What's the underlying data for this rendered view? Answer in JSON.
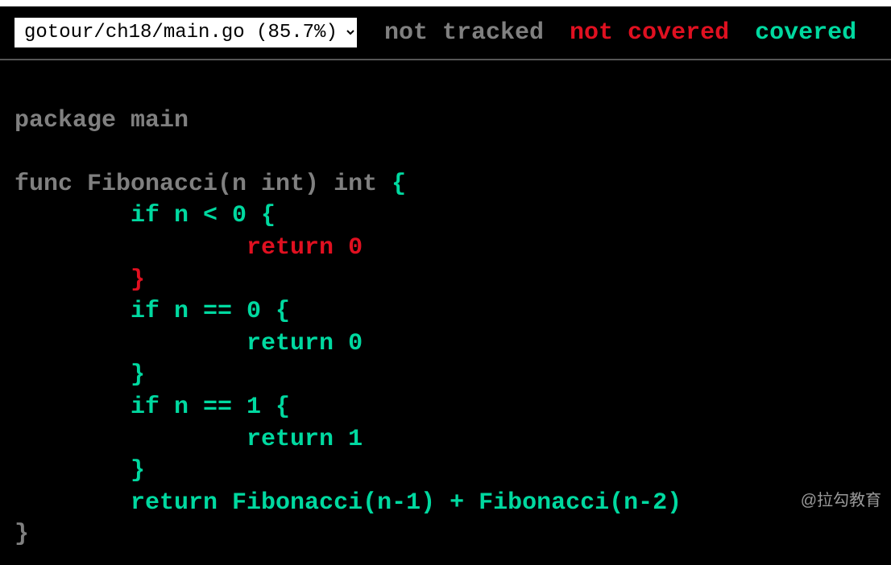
{
  "topbar": {
    "selected_file": "gotour/ch18/main.go (85.7%)",
    "legend": {
      "not_tracked": "not tracked",
      "not_covered": "not covered",
      "covered": "covered"
    }
  },
  "code": {
    "line1": "package main",
    "line2": "",
    "line3_a": "func Fibonacci(n int) int ",
    "line3_b": "{",
    "line4": "        if n < 0 {",
    "line5": "                return 0",
    "line6": "        }",
    "line7": "        if n == 0 {",
    "line8": "                return 0",
    "line9": "        }",
    "line10": "        if n == 1 {",
    "line11": "                return 1",
    "line12": "        }",
    "line13": "        return Fibonacci(n-1) + Fibonacci(n-2)",
    "line14": "}"
  },
  "watermark": "@拉勾教育"
}
